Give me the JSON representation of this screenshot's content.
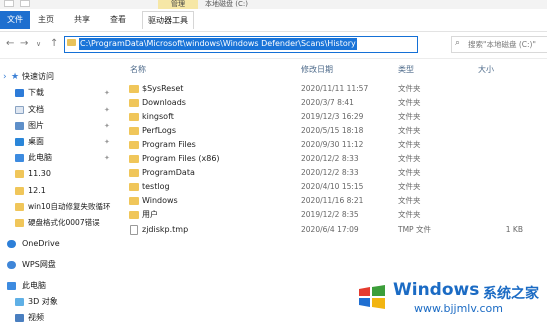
{
  "window": {
    "manage_tab": "管理",
    "title": "本地磁盘 (C:)"
  },
  "ribbon": {
    "tabs": [
      "文件",
      "主页",
      "共享",
      "查看"
    ],
    "contextual_tab": "驱动器工具"
  },
  "nav": {
    "back_glyph": "←",
    "forward_glyph": "→",
    "recent_glyph": "∨",
    "up_glyph": "↑",
    "address": "C:\\ProgramData\\Microsoft\\windows\\Windows Defender\\Scans\\History",
    "search_placeholder": "搜索\"本地磁盘 (C:)\""
  },
  "sidebar": {
    "quick_access": "快速访问",
    "items": [
      {
        "label": "下载",
        "icon": "download-icon",
        "pinned": true
      },
      {
        "label": "文档",
        "icon": "document-icon",
        "pinned": true
      },
      {
        "label": "图片",
        "icon": "picture-icon",
        "pinned": true
      },
      {
        "label": "桌面",
        "icon": "desktop-icon",
        "pinned": true
      },
      {
        "label": "此电脑",
        "icon": "computer-icon",
        "pinned": true
      },
      {
        "label": "11.30",
        "icon": "folder-icon",
        "pinned": false
      },
      {
        "label": "12.1",
        "icon": "folder-icon",
        "pinned": false
      },
      {
        "label": "win10自动修复失败循环",
        "icon": "folder-icon",
        "pinned": false
      },
      {
        "label": "硬盘格式化0007错误",
        "icon": "folder-icon",
        "pinned": false
      }
    ],
    "onedrive": "OneDrive",
    "wps": "WPS网盘",
    "this_pc": "此电脑",
    "pc_items": [
      "3D 对象",
      "视频"
    ]
  },
  "columns": {
    "name": "名称",
    "date": "修改日期",
    "type": "类型",
    "size": "大小"
  },
  "files": [
    {
      "name": "$SysReset",
      "date": "2020/11/11 11:57",
      "type": "文件夹",
      "size": "",
      "kind": "folder"
    },
    {
      "name": "Downloads",
      "date": "2020/3/7 8:41",
      "type": "文件夹",
      "size": "",
      "kind": "folder"
    },
    {
      "name": "kingsoft",
      "date": "2019/12/3 16:29",
      "type": "文件夹",
      "size": "",
      "kind": "folder"
    },
    {
      "name": "PerfLogs",
      "date": "2020/5/15 18:18",
      "type": "文件夹",
      "size": "",
      "kind": "folder"
    },
    {
      "name": "Program Files",
      "date": "2020/9/30 11:12",
      "type": "文件夹",
      "size": "",
      "kind": "folder"
    },
    {
      "name": "Program Files (x86)",
      "date": "2020/12/2 8:33",
      "type": "文件夹",
      "size": "",
      "kind": "folder"
    },
    {
      "name": "ProgramData",
      "date": "2020/12/2 8:33",
      "type": "文件夹",
      "size": "",
      "kind": "folder"
    },
    {
      "name": "testlog",
      "date": "2020/4/10 15:15",
      "type": "文件夹",
      "size": "",
      "kind": "folder"
    },
    {
      "name": "Windows",
      "date": "2020/11/16 8:21",
      "type": "文件夹",
      "size": "",
      "kind": "folder"
    },
    {
      "name": "用户",
      "date": "2019/12/2 8:35",
      "type": "文件夹",
      "size": "",
      "kind": "folder"
    },
    {
      "name": "zjdiskp.tmp",
      "date": "2020/6/4 17:09",
      "type": "TMP 文件",
      "size": "1 KB",
      "kind": "file"
    }
  ],
  "watermark": {
    "brand": "Windows",
    "cn": "系统之家",
    "url": "www.bjjmlv.com"
  },
  "colors": {
    "accent": "#1a74d8",
    "file_tab": "#1e6fcf",
    "manage_tab": "#f6e7a6",
    "folder": "#f0c65a",
    "watermark": "#1b6bc4"
  }
}
